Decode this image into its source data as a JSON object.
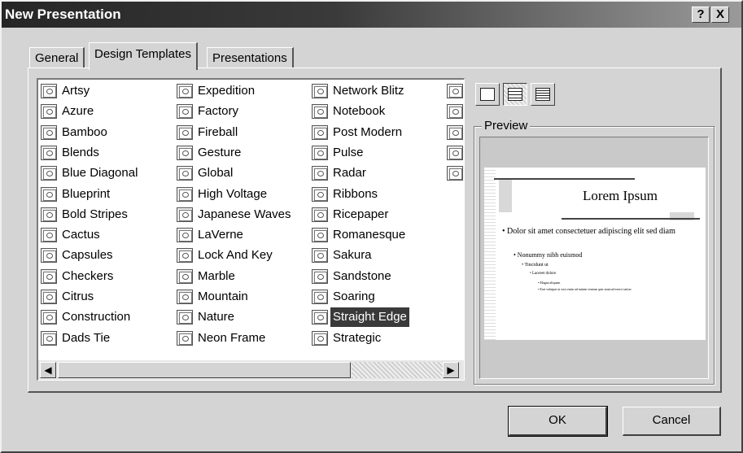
{
  "window": {
    "title": "New Presentation",
    "help_button": "?",
    "close_button": "X"
  },
  "tabs": [
    {
      "label": "General"
    },
    {
      "label": "Design Templates"
    },
    {
      "label": "Presentations"
    }
  ],
  "active_tab": "Design Templates",
  "templates": {
    "columns": [
      [
        "Artsy",
        "Azure",
        "Bamboo",
        "Blends",
        "Blue Diagonal",
        "Blueprint",
        "Bold Stripes",
        "Cactus",
        "Capsules",
        "Checkers",
        "Citrus",
        "Construction",
        "Dads Tie"
      ],
      [
        "Expedition",
        "Factory",
        "Fireball",
        "Gesture",
        "Global",
        "High Voltage",
        "Japanese Waves",
        "LaVerne",
        "Lock And Key",
        "Marble",
        "Mountain",
        "Nature",
        "Neon Frame"
      ],
      [
        "Network Blitz",
        "Notebook",
        "Post Modern",
        "Pulse",
        "Radar",
        "Ribbons",
        "Ricepaper",
        "Romanesque",
        "Sakura",
        "Sandstone",
        "Soaring",
        "Straight Edge",
        "Strategic"
      ]
    ],
    "partial_column_icon_count": 5,
    "selected": "Straight Edge",
    "icon": "template-file-icon"
  },
  "scrollbar": {
    "left_arrow": "◀",
    "right_arrow": "▶"
  },
  "view_buttons": [
    {
      "name": "large-icons-view-icon",
      "pressed": false
    },
    {
      "name": "list-view-icon",
      "pressed": true
    },
    {
      "name": "details-view-icon",
      "pressed": false
    }
  ],
  "preview": {
    "label": "Preview",
    "slide_title": "Lorem Ipsum",
    "bullet1": "• Dolor sit amet consectetuer adipiscing elit sed diam",
    "bullet2": "• Nonummy nibh euismod",
    "bullet3": "• Tincidunt ut",
    "bullet4": "• Laoreet dolore",
    "bullet5": "• Magna aliquam",
    "bullet6": "• Erat volutpat ut wisi enim ad minim veniam quis nostrud exerci tation"
  },
  "buttons": {
    "ok": "OK",
    "cancel": "Cancel"
  }
}
